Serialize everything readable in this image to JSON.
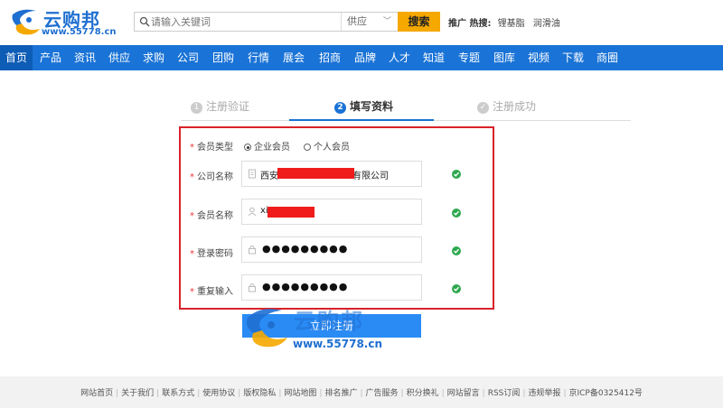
{
  "header": {
    "logo_text": "云购邦",
    "logo_url": "www.55778.cn",
    "search_placeholder": "请输入关键词",
    "search_category": "供应",
    "search_button": "搜索",
    "hot_label": "推广 热搜:",
    "hot_keywords": [
      "锂基脂",
      "润滑油"
    ]
  },
  "nav": {
    "items": [
      "首页",
      "产品",
      "资讯",
      "供应",
      "求购",
      "公司",
      "团购",
      "行情",
      "展会",
      "招商",
      "品牌",
      "人才",
      "知道",
      "专题",
      "图库",
      "视频",
      "下载",
      "商圈"
    ],
    "active_index": 0
  },
  "steps": [
    {
      "num": "1",
      "label": "注册验证",
      "state": "done"
    },
    {
      "num": "2",
      "label": "填写资料",
      "state": "active"
    },
    {
      "num": "✓",
      "label": "注册成功",
      "state": "pending"
    }
  ],
  "form": {
    "member_type_label": "会员类型",
    "member_type_options": [
      "企业会员",
      "个人会员"
    ],
    "member_type_selected": 0,
    "company_label": "公司名称",
    "company_value_prefix": "西安",
    "company_value_suffix": "有限公司",
    "member_name_label": "会员名称",
    "member_name_value": "xi",
    "password_label": "登录密码",
    "password_value": "●●●●●●●●●",
    "confirm_label": "重复输入",
    "confirm_value": "●●●●●●●●●",
    "submit_label": "立即注册"
  },
  "watermark": {
    "text": "云购邦",
    "url": "www.55778.cn"
  },
  "footer": {
    "links": [
      "网站首页",
      "关于我们",
      "联系方式",
      "使用协议",
      "版权隐私",
      "网站地图",
      "排名推广",
      "广告服务",
      "积分换礼",
      "网站留言",
      "RSS订阅",
      "违规举报",
      "京ICP备0325412号"
    ]
  },
  "colors": {
    "brand_blue": "#1a73d6",
    "search_button": "#f5a800",
    "highlight_border": "#d9222a",
    "valid_green": "#2ea84e",
    "submit_blue": "#2a8bf5"
  },
  "icons": [
    "logo-swirl-icon",
    "search-icon",
    "chevron-down-icon",
    "building-icon",
    "user-icon",
    "lock-icon",
    "check-circle-icon"
  ]
}
